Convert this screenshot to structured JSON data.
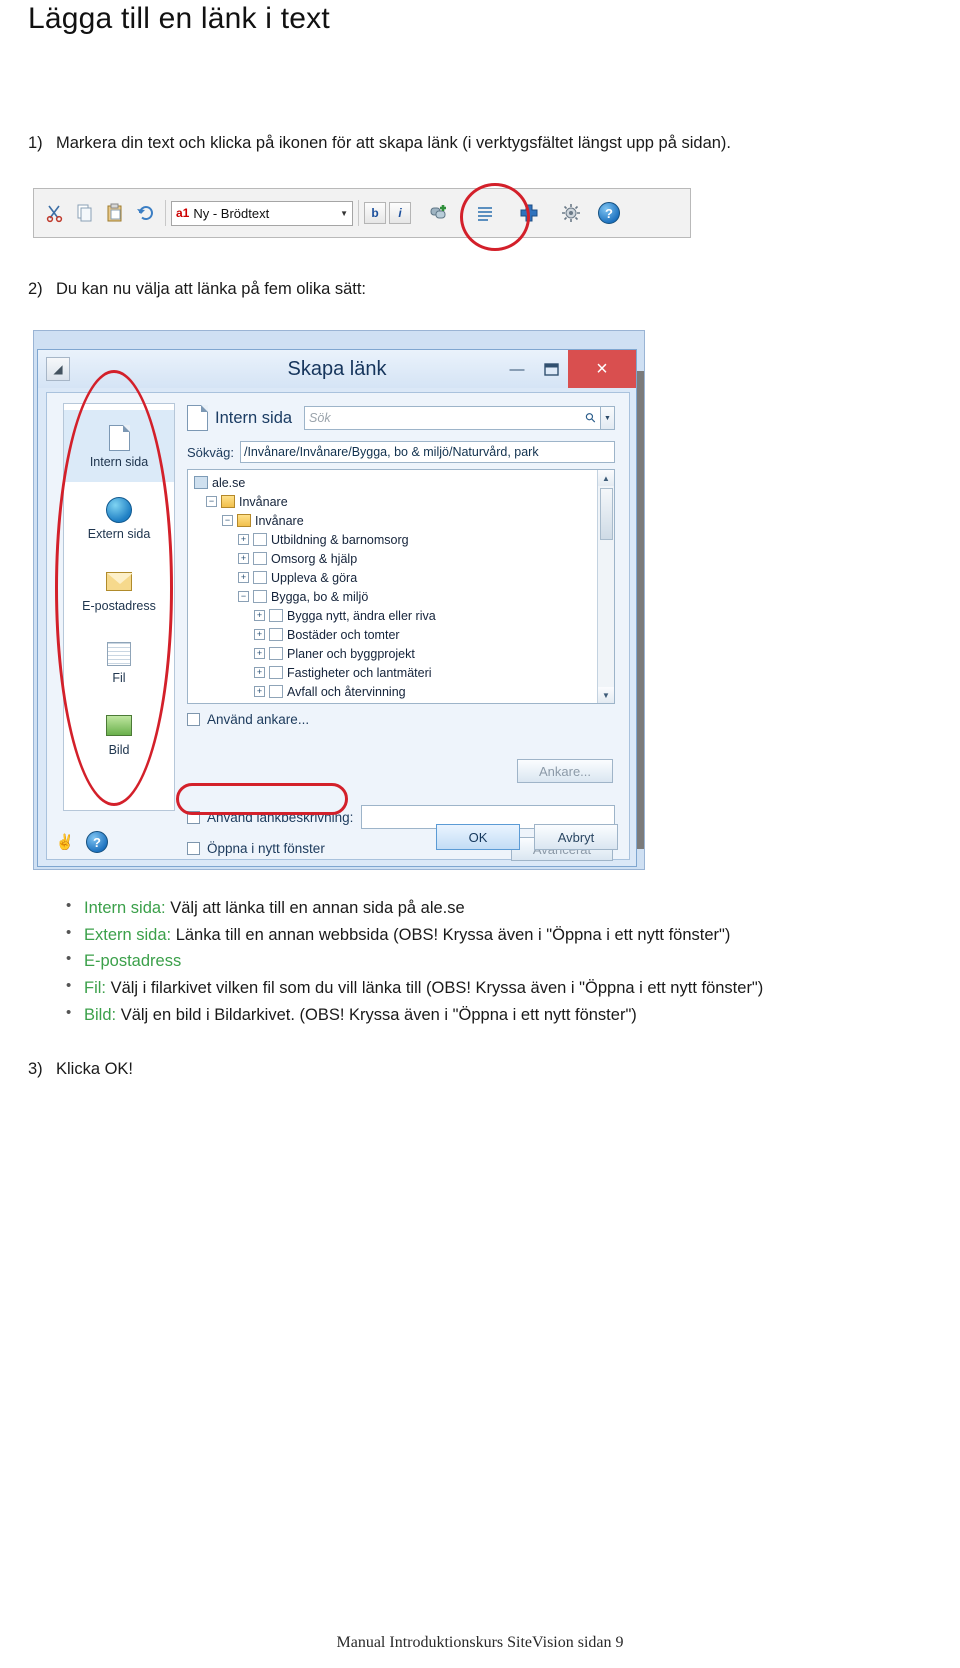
{
  "document": {
    "title": "Lägga till en länk i text",
    "footer": "Manual Introduktionskurs SiteVision sidan 9"
  },
  "steps": [
    {
      "num": "1)",
      "text": "Markera din text och klicka på ikonen för att skapa länk (i verktygsfältet längst upp på sidan)."
    },
    {
      "num": "2)",
      "text": "Du kan nu välja att länka på fem olika sätt:"
    },
    {
      "num": "3)",
      "text": "Klicka OK!"
    }
  ],
  "toolbar": {
    "style_combo_value": "Ny - Brödtext",
    "style_combo_icon": "a1",
    "buttons": [
      {
        "name": "cut-icon",
        "glyph": "✂"
      },
      {
        "name": "copy-icon",
        "glyph": "❐"
      },
      {
        "name": "paste-icon",
        "glyph": "ὌB"
      },
      {
        "name": "undo-icon",
        "glyph": "↶"
      }
    ],
    "bold_label": "b",
    "italic_label": "i",
    "link_icon": "link-icon",
    "list_icon": "list-icon",
    "add_icon": "add-icon",
    "settings_icon": "settings-icon",
    "help_icon": "?"
  },
  "dialog": {
    "title": "Skapa länk",
    "window_buttons": {
      "minimize": "—",
      "maximize": "❐",
      "close": "×"
    },
    "side_items": [
      {
        "label": "Intern sida",
        "icon": "page-icon",
        "active": true
      },
      {
        "label": "Extern sida",
        "icon": "globe-icon",
        "active": false
      },
      {
        "label": "E-postadress",
        "icon": "mail-icon",
        "active": false
      },
      {
        "label": "Fil",
        "icon": "file-icon",
        "active": false
      },
      {
        "label": "Bild",
        "icon": "image-icon",
        "active": false
      }
    ],
    "panel_title": "Intern sida",
    "search_placeholder": "Sök",
    "path_label": "Sökväg:",
    "path_value": "/Invånare/Invånare/Bygga, bo & miljö/Naturvård, park",
    "tree": [
      {
        "label": "ale.se",
        "indent": 0,
        "icon": "home-icon",
        "expander": ""
      },
      {
        "label": "Invånare",
        "indent": 1,
        "icon": "folder-icon",
        "expander": "−"
      },
      {
        "label": "Invånare",
        "indent": 2,
        "icon": "folder-icon",
        "expander": "−"
      },
      {
        "label": "Utbildning & barnomsorg",
        "indent": 3,
        "icon": "doc-icon",
        "expander": "+"
      },
      {
        "label": "Omsorg & hjälp",
        "indent": 3,
        "icon": "doc-icon",
        "expander": "+"
      },
      {
        "label": "Uppleva & göra",
        "indent": 3,
        "icon": "doc-icon",
        "expander": "+"
      },
      {
        "label": "Bygga, bo & miljö",
        "indent": 3,
        "icon": "doc-icon",
        "expander": "−"
      },
      {
        "label": "Bygga nytt, ändra eller riva",
        "indent": 4,
        "icon": "doc-icon",
        "expander": "+"
      },
      {
        "label": "Bostäder och tomter",
        "indent": 4,
        "icon": "doc-icon",
        "expander": "+"
      },
      {
        "label": "Planer och byggprojekt",
        "indent": 4,
        "icon": "doc-icon",
        "expander": "+"
      },
      {
        "label": "Fastigheter och lantmäteri",
        "indent": 4,
        "icon": "doc-icon",
        "expander": "+"
      },
      {
        "label": "Avfall och återvinning",
        "indent": 4,
        "icon": "doc-icon",
        "expander": "+"
      }
    ],
    "use_anchor_label": "Använd ankare...",
    "anchor_button": "Ankare...",
    "use_linkdesc_label": "Använd länkbeskrivning:",
    "new_window_label": "Öppna i nytt fönster",
    "advanced_button": "Avancerat",
    "ok_button": "OK",
    "cancel_button": "Avbryt"
  },
  "bullets": [
    {
      "term": "Intern sida:",
      "text": " Välj att länka till en annan sida på ale.se"
    },
    {
      "term": "Extern sida:",
      "text": " Länka till en annan webbsida (OBS! Kryssa även i \"Öppna i ett nytt fönster\")"
    },
    {
      "term": "E-postadress",
      "text": ""
    },
    {
      "term": "Fil:",
      "text": " Välj i filarkivet vilken fil som du vill länka till (OBS! Kryssa även i \"Öppna i ett nytt fönster\")"
    },
    {
      "term": "Bild:",
      "text": " Välj en bild i Bildarkivet. (OBS! Kryssa även i \"Öppna i ett nytt fönster\")"
    }
  ],
  "colors": {
    "accent_green": "#3ba04a",
    "annotation_red": "#d3202a",
    "close_red": "#d94f4f"
  }
}
